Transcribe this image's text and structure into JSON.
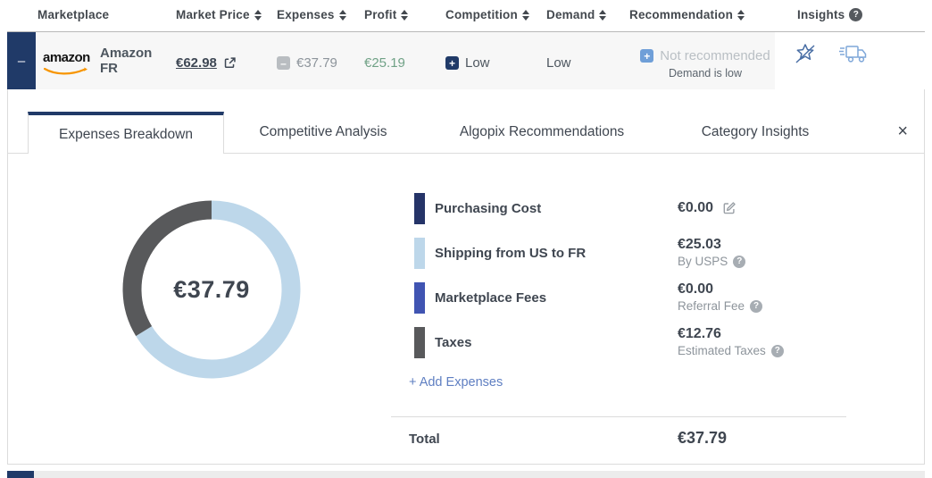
{
  "colors": {
    "accent_navy": "#203a68",
    "link_blue": "#5f7fc2",
    "profit_green": "#71a287",
    "purchasing_bar": "#253468",
    "shipping_bar": "#bdd7ea",
    "fees_bar": "#4054b2",
    "taxes_bar": "#58595b",
    "amazon_smile": "#f79500",
    "recommendation_plus": "#6f9fd8"
  },
  "table": {
    "headers": [
      {
        "label": "Marketplace",
        "sortable": false
      },
      {
        "label": "Market Price",
        "sortable": true
      },
      {
        "label": "Expenses",
        "sortable": true
      },
      {
        "label": "Profit",
        "sortable": true
      },
      {
        "label": "Competition",
        "sortable": true
      },
      {
        "label": "Demand",
        "sortable": true
      },
      {
        "label": "Recommendation",
        "sortable": true
      },
      {
        "label": "Insights",
        "help": "?"
      }
    ],
    "row": {
      "expander": "–",
      "logo": "amazon",
      "name_line1": "Amazon",
      "name_line2": "FR",
      "market_price": "€62.98",
      "expenses_minus": "–",
      "expenses": "€37.79",
      "profit": "€25.19",
      "competition_plus": "+",
      "competition": "Low",
      "demand": "Low",
      "recommendation_plus": "+",
      "recommendation": "Not recommended",
      "recommendation_note": "Demand is low",
      "insights_icons": [
        "no-bestseller-icon",
        "shipping-truck-icon"
      ]
    }
  },
  "tabs": {
    "items": [
      {
        "label": "Expenses Breakdown",
        "active": true
      },
      {
        "label": "Competitive Analysis",
        "active": false
      },
      {
        "label": "Algopix Recommendations",
        "active": false
      },
      {
        "label": "Category Insights",
        "active": false
      }
    ],
    "close": "×"
  },
  "chart_data": {
    "type": "pie",
    "variant": "donut",
    "center_label": "€37.79",
    "total": 37.79,
    "currency": "EUR",
    "slices": [
      {
        "label": "Purchasing Cost",
        "value": 0.0,
        "color": "#253468"
      },
      {
        "label": "Shipping from US to FR",
        "value": 25.03,
        "color": "#bdd7ea"
      },
      {
        "label": "Marketplace Fees",
        "value": 0.0,
        "color": "#4054b2"
      },
      {
        "label": "Taxes",
        "value": 12.76,
        "color": "#58595b"
      }
    ],
    "legend_position": "right",
    "start_angle_deg": 0,
    "direction": "clockwise"
  },
  "expenses_panel": {
    "items": [
      {
        "label": "Purchasing Cost",
        "value": "€0.00",
        "sub": "",
        "color": "#253468",
        "editable": true
      },
      {
        "label": "Shipping from US to FR",
        "value": "€25.03",
        "sub": "By USPS",
        "color": "#bdd7ea",
        "help": "?"
      },
      {
        "label": "Marketplace Fees",
        "value": "€0.00",
        "sub": "Referral Fee",
        "color": "#4054b2",
        "help": "?"
      },
      {
        "label": "Taxes",
        "value": "€12.76",
        "sub": "Estimated Taxes",
        "color": "#58595b",
        "help": "?"
      }
    ],
    "add_label": "+ Add Expenses",
    "total_label": "Total",
    "total_value": "€37.79"
  }
}
